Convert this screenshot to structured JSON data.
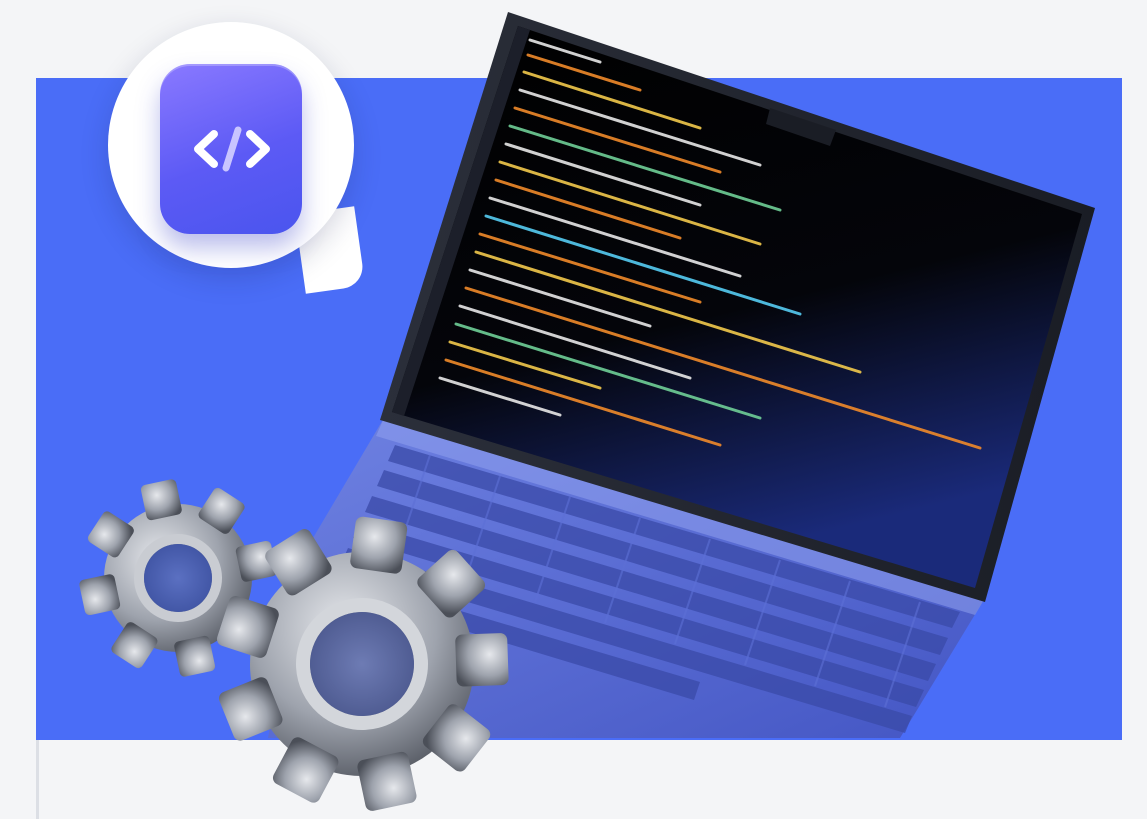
{
  "scene": {
    "background_color": "#f4f5f7",
    "panel_color": "#4a6df7",
    "bubble_color": "#ffffff"
  },
  "app_icon": {
    "icon_name": "code-brackets-icon",
    "gradient_start": "#8a79ff",
    "gradient_end": "#4a55ee"
  },
  "laptop": {
    "screen_color": "#050608",
    "body_color": "#4f62c9"
  },
  "gears": {
    "icon_name": "gear-icon",
    "color": "#9ea3ad",
    "count": 2
  }
}
